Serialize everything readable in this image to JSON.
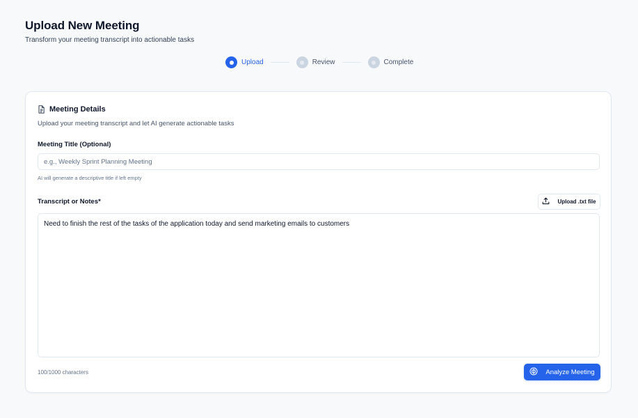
{
  "header": {
    "title": "Upload New Meeting",
    "subtitle": "Transform your meeting transcript into actionable tasks"
  },
  "stepper": {
    "steps": [
      {
        "label": "Upload",
        "state": "active"
      },
      {
        "label": "Review",
        "state": "inactive"
      },
      {
        "label": "Complete",
        "state": "inactive"
      }
    ]
  },
  "card": {
    "icon": "document-icon",
    "title": "Meeting Details",
    "description": "Upload your meeting transcript and let AI generate actionable tasks",
    "title_field": {
      "label": "Meeting Title (Optional)",
      "value": "",
      "placeholder": "e.g., Weekly Sprint Planning Meeting",
      "hint": "AI will generate a descriptive title if left empty"
    },
    "transcript_field": {
      "label": "Transcript or Notes*",
      "value": "Need to finish the rest of the tasks of the application today and send marketing emails to customers",
      "upload_label": "Upload .txt file",
      "upload_icon": "upload-icon",
      "char_count": "100/1000 characters"
    },
    "analyze": {
      "label": "Analyze Meeting",
      "icon": "brain-icon"
    }
  },
  "colors": {
    "accent": "#2563eb",
    "background": "#f8f9fb",
    "border": "#e2e8f0",
    "inactive_step": "#cbd5e1"
  }
}
